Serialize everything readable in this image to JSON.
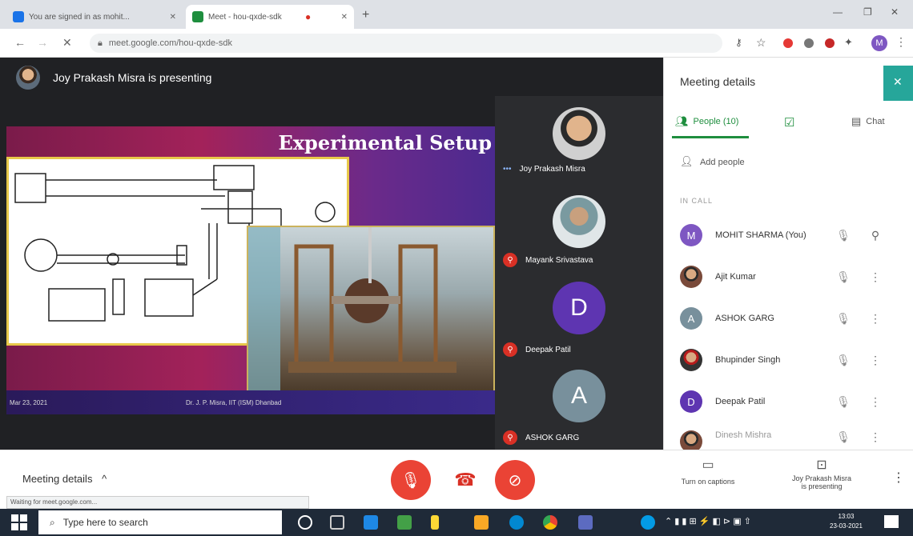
{
  "browser": {
    "tabs": [
      {
        "title": "You are signed in as mohit...",
        "favicon_color": "#1a73e8"
      },
      {
        "title": "Meet - hou-qxde-sdk",
        "favicon_color": "#1e8e3e"
      }
    ],
    "url": "meet.google.com/hou-qxde-sdk",
    "profile_initial": "M"
  },
  "stage": {
    "presenting_text": "Joy Prakash Misra is presenting",
    "slide_title": "Experimental Setup",
    "slide_footer_date": "Mar 23, 2021",
    "slide_footer_author": "Dr. J. P. Misra, IIT (ISM) Dhanbad"
  },
  "tiles": [
    {
      "name": "Joy Prakash Misra",
      "initial": "",
      "color": "#5c6b7a",
      "kind": "photo",
      "muted": false
    },
    {
      "name": "Mayank Srivastava",
      "initial": "",
      "color": "#8aa3a8",
      "kind": "photo",
      "muted": true
    },
    {
      "name": "Deepak Patil",
      "initial": "D",
      "color": "#5e35b1",
      "kind": "letter",
      "muted": true
    },
    {
      "name": "ASHOK GARG",
      "initial": "A",
      "color": "#78909c",
      "kind": "letter",
      "muted": true
    }
  ],
  "panel": {
    "title": "Meeting details",
    "tab_people": "People (10)",
    "tab_chat": "Chat",
    "add_people": "Add people",
    "in_call": "IN CALL",
    "people": [
      {
        "name": "MOHIT SHARMA (You)",
        "initial": "M",
        "color": "#7e57c2",
        "kind": "letter"
      },
      {
        "name": "Ajit Kumar",
        "initial": "",
        "color": "#6d4c41",
        "kind": "photo"
      },
      {
        "name": "ASHOK GARG",
        "initial": "A",
        "color": "#78909c",
        "kind": "letter"
      },
      {
        "name": "Bhupinder Singh",
        "initial": "",
        "color": "#8d6e63",
        "kind": "photo"
      },
      {
        "name": "Deepak Patil",
        "initial": "D",
        "color": "#5e35b1",
        "kind": "letter"
      },
      {
        "name": "Dinesh Mishra",
        "initial": "",
        "color": "#a1887f",
        "kind": "photo"
      }
    ]
  },
  "bottom": {
    "meeting_details": "Meeting details",
    "captions": "Turn on captions",
    "presenting_line1": "Joy Prakash Misra",
    "presenting_line2": "is presenting",
    "status_text": "Waiting for meet.google.com..."
  },
  "taskbar": {
    "search_placeholder": "Type here to search",
    "time": "13:03",
    "date": "23-03-2021"
  },
  "colors": {
    "accent_red": "#ea4335",
    "meet_green": "#1e8e3e",
    "close_teal": "#26a69a"
  }
}
